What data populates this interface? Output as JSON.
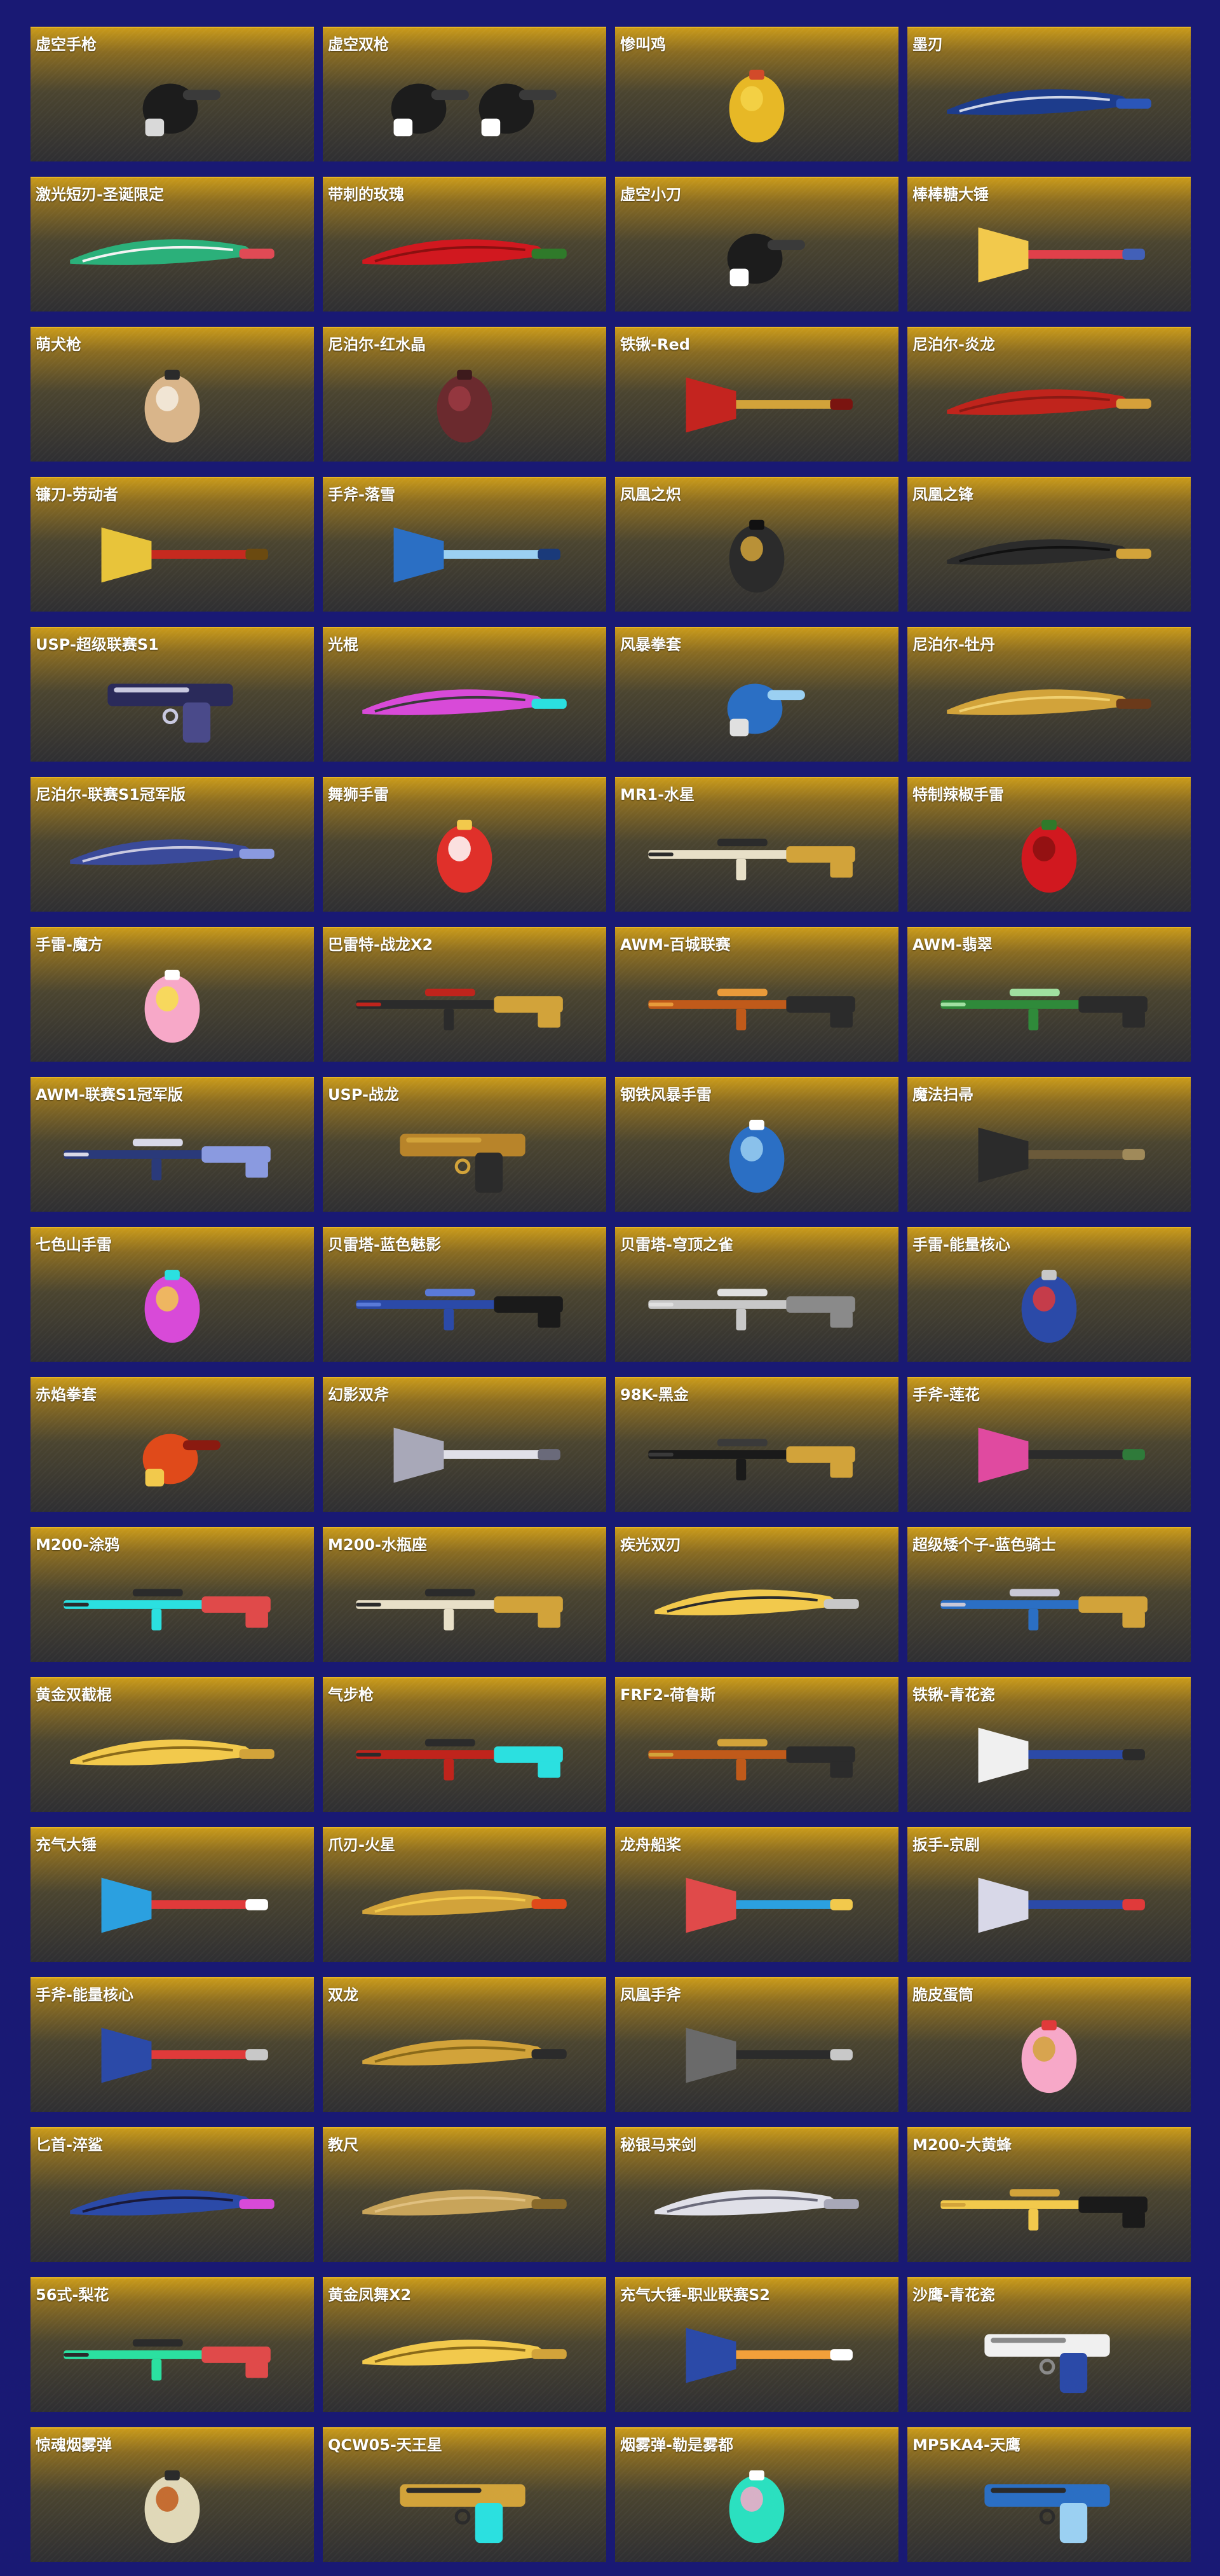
{
  "items": [
    {
      "name": "虚空手枪",
      "icon": "black-glove-finger-gun-icon",
      "colors": [
        "#1c1c1c",
        "#3a3a3a",
        "#d9d9d9"
      ]
    },
    {
      "name": "虚空双枪",
      "icon": "twin-black-glove-finger-guns-icon",
      "colors": [
        "#1c1c1c",
        "#3a3a3a",
        "#ffffff"
      ]
    },
    {
      "name": "惨叫鸡",
      "icon": "rubber-chicken-icon",
      "colors": [
        "#e7b826",
        "#f5d44a",
        "#d24a2a"
      ]
    },
    {
      "name": "墨刃",
      "icon": "folding-knife-blue-icon",
      "colors": [
        "#1d3c8c",
        "#2b56b8",
        "#cfd6e8"
      ]
    },
    {
      "name": "激光短刃-圣诞限定",
      "icon": "christmas-laser-blade-icon",
      "colors": [
        "#2bb07a",
        "#e04a55",
        "#f3f3f3"
      ]
    },
    {
      "name": "带刺的玫瑰",
      "icon": "rose-icon",
      "colors": [
        "#d1181f",
        "#2f7a2a",
        "#8a1010"
      ]
    },
    {
      "name": "虚空小刀",
      "icon": "black-glove-hand-icon",
      "colors": [
        "#1c1c1c",
        "#3a3a3a",
        "#ffffff"
      ]
    },
    {
      "name": "棒棒糖大锤",
      "icon": "lollipop-hammer-icon",
      "colors": [
        "#f2c94c",
        "#e0404a",
        "#4260b8"
      ]
    },
    {
      "name": "萌犬枪",
      "icon": "shiba-dog-icon",
      "colors": [
        "#d9b58a",
        "#f5ede0",
        "#2b2b2b"
      ]
    },
    {
      "name": "尼泊尔-红水晶",
      "icon": "red-crystal-kukri-icon",
      "colors": [
        "#6b2a2e",
        "#9b3a42",
        "#3d1a1c"
      ]
    },
    {
      "name": "铁锹-Red",
      "icon": "red-dragon-shovel-icon",
      "colors": [
        "#c4241f",
        "#d2a33a",
        "#7a1410"
      ]
    },
    {
      "name": "尼泊尔-炎龙",
      "icon": "flame-dragon-kukri-icon",
      "colors": [
        "#c0241c",
        "#d6a03a",
        "#8a1a14"
      ]
    },
    {
      "name": "镰刀-劳动者",
      "icon": "golden-sickle-icon",
      "colors": [
        "#e8c43a",
        "#c62a1f",
        "#6b4a10"
      ]
    },
    {
      "name": "手斧-落雪",
      "icon": "snow-axe-icon",
      "colors": [
        "#2b6fc4",
        "#9bd0f2",
        "#1a3a7a"
      ]
    },
    {
      "name": "凤凰之炽",
      "icon": "phoenix-grenade-icon",
      "colors": [
        "#2b2b2b",
        "#d2a33a",
        "#111111"
      ]
    },
    {
      "name": "凤凰之锋",
      "icon": "phoenix-blade-icon",
      "colors": [
        "#2b2b2b",
        "#d2a33a",
        "#111111"
      ]
    },
    {
      "name": "USP-超级联赛S1",
      "icon": "usp-silenced-pistol-icon",
      "colors": [
        "#2a2a5a",
        "#4a4a8a",
        "#c9c9e0"
      ]
    },
    {
      "name": "光棍",
      "icon": "neon-stick-icon",
      "colors": [
        "#d84ad8",
        "#2be0e0",
        "#3a3a3a"
      ]
    },
    {
      "name": "风暴拳套",
      "icon": "storm-glove-icon",
      "colors": [
        "#2b6fc4",
        "#9bd0f2",
        "#e0e0e0"
      ]
    },
    {
      "name": "尼泊尔-牡丹",
      "icon": "peony-kukri-icon",
      "colors": [
        "#d2a33a",
        "#6b3a1a",
        "#f0d070"
      ]
    },
    {
      "name": "尼泊尔-联赛S1冠军版",
      "icon": "league-kukri-icon",
      "colors": [
        "#3a4a9a",
        "#8a9ae0",
        "#c9c9e0"
      ]
    },
    {
      "name": "舞狮手雷",
      "icon": "lion-dance-grenade-icon",
      "colors": [
        "#e0302a",
        "#ffffff",
        "#f2c94c"
      ]
    },
    {
      "name": "MR1-水星",
      "icon": "mercury-sniper-icon",
      "colors": [
        "#e8e0c8",
        "#d2a33a",
        "#2b2b2b"
      ]
    },
    {
      "name": "特制辣椒手雷",
      "icon": "chili-pepper-icon",
      "colors": [
        "#d1181f",
        "#8a1010",
        "#2f7a2a"
      ]
    },
    {
      "name": "手雷-魔方",
      "icon": "rubiks-cube-icon",
      "colors": [
        "#f7a8c8",
        "#f7e04a",
        "#ffffff"
      ]
    },
    {
      "name": "巴雷特-战龙X2",
      "icon": "barrett-war-dragon-icon",
      "colors": [
        "#2b2b2b",
        "#d2a33a",
        "#c0241c"
      ]
    },
    {
      "name": "AWM-百城联赛",
      "icon": "awm-league-sniper-icon",
      "colors": [
        "#c05a1a",
        "#2b2b2b",
        "#e89a3a"
      ]
    },
    {
      "name": "AWM-翡翠",
      "icon": "awm-jade-sniper-icon",
      "colors": [
        "#2f8a3a",
        "#2b2b2b",
        "#a0e0a0"
      ]
    },
    {
      "name": "AWM-联赛S1冠军版",
      "icon": "awm-champion-sniper-icon",
      "colors": [
        "#2a3a7a",
        "#8a9ae0",
        "#d9d9e8"
      ]
    },
    {
      "name": "USP-战龙",
      "icon": "usp-war-dragon-icon",
      "colors": [
        "#b8842a",
        "#2b2b2b",
        "#d2a33a"
      ]
    },
    {
      "name": "钢铁风暴手雷",
      "icon": "blue-orb-grenade-icon",
      "colors": [
        "#2b6fc4",
        "#9bd0f2",
        "#ffffff"
      ]
    },
    {
      "name": "魔法扫帚",
      "icon": "magic-broom-icon",
      "colors": [
        "#2b2b2b",
        "#6b5a3a",
        "#a08a5a"
      ]
    },
    {
      "name": "七色山手雷",
      "icon": "seven-color-crystal-icon",
      "colors": [
        "#d84ad8",
        "#f2c94c",
        "#2be0e0"
      ]
    },
    {
      "name": "贝雷塔-蓝色魅影",
      "icon": "beretta-blue-shotgun-icon",
      "colors": [
        "#2b4aa8",
        "#1a1a1a",
        "#5a7ad8"
      ]
    },
    {
      "name": "贝雷塔-穹顶之雀",
      "icon": "beretta-silver-shotgun-icon",
      "colors": [
        "#c8c8c8",
        "#8a8a8a",
        "#e0e0e0"
      ]
    },
    {
      "name": "手雷-能量核心",
      "icon": "energy-core-grenade-icon",
      "colors": [
        "#2b4aa8",
        "#e03a3a",
        "#c8c8c8"
      ]
    },
    {
      "name": "赤焰拳套",
      "icon": "flame-glove-icon",
      "colors": [
        "#e04a1a",
        "#8a1a10",
        "#f2c94c"
      ]
    },
    {
      "name": "幻影双斧",
      "icon": "phantom-double-axe-icon",
      "colors": [
        "#a8a8b8",
        "#e0e0e8",
        "#6a6a7a"
      ]
    },
    {
      "name": "98K-黑金",
      "icon": "98k-black-gold-rifle-icon",
      "colors": [
        "#1a1a1a",
        "#d2a33a",
        "#3a3a3a"
      ]
    },
    {
      "name": "手斧-莲花",
      "icon": "lotus-axe-icon",
      "colors": [
        "#e04aa0",
        "#2b2b2b",
        "#2f7a3a"
      ]
    },
    {
      "name": "M200-涂鸦",
      "icon": "m200-graffiti-sniper-icon",
      "colors": [
        "#2be0e0",
        "#e04a4a",
        "#2b2b2b"
      ]
    },
    {
      "name": "M200-水瓶座",
      "icon": "m200-aquarius-sniper-icon",
      "colors": [
        "#e8e0c8",
        "#d2a33a",
        "#2b2b2b"
      ]
    },
    {
      "name": "疾光双刃",
      "icon": "swift-light-blade-icon",
      "colors": [
        "#f2c94c",
        "#c8c8c8",
        "#2b2b2b"
      ]
    },
    {
      "name": "超级矮个子-蓝色骑士",
      "icon": "blue-knight-shotgun-icon",
      "colors": [
        "#2b6fc4",
        "#d2a33a",
        "#c8c8d8"
      ]
    },
    {
      "name": "黄金双截棍",
      "icon": "golden-nunchaku-icon",
      "colors": [
        "#f2c94c",
        "#d2a33a",
        "#8a6a1a"
      ]
    },
    {
      "name": "气步枪",
      "icon": "air-rifle-icon",
      "colors": [
        "#c0241c",
        "#2be0e0",
        "#2b2b2b"
      ]
    },
    {
      "name": "FRF2-荷鲁斯",
      "icon": "frf2-horus-sniper-icon",
      "colors": [
        "#c05a1a",
        "#2b2b2b",
        "#d2a33a"
      ]
    },
    {
      "name": "铁锹-青花瓷",
      "icon": "porcelain-shovel-icon",
      "colors": [
        "#f0f0f0",
        "#2b4aa8",
        "#2b2b2b"
      ]
    },
    {
      "name": "充气大锤",
      "icon": "inflatable-hammer-icon",
      "colors": [
        "#2ba0e0",
        "#e03a3a",
        "#ffffff"
      ]
    },
    {
      "name": "爪刃-火星",
      "icon": "mars-claw-icon",
      "colors": [
        "#d2a33a",
        "#e04a1a",
        "#f2c94c"
      ]
    },
    {
      "name": "龙舟船桨",
      "icon": "dragon-boat-paddle-icon",
      "colors": [
        "#e04a4a",
        "#2ba0e0",
        "#f2c94c"
      ]
    },
    {
      "name": "扳手-京剧",
      "icon": "opera-wrench-icon",
      "colors": [
        "#d8d8e8",
        "#2b4aa8",
        "#e03a3a"
      ]
    },
    {
      "name": "手斧-能量核心",
      "icon": "energy-core-axe-icon",
      "colors": [
        "#2b4aa8",
        "#e03a3a",
        "#c8c8c8"
      ]
    },
    {
      "name": "双龙",
      "icon": "twin-dragon-spear-icon",
      "colors": [
        "#d2a33a",
        "#2b2b2b",
        "#8a6a1a"
      ]
    },
    {
      "name": "凤凰手斧",
      "icon": "phoenix-axe-icon",
      "colors": [
        "#6a6a6a",
        "#2b2b2b",
        "#c8c8c8"
      ]
    },
    {
      "name": "脆皮蛋筒",
      "icon": "ice-cream-cone-icon",
      "colors": [
        "#f7a8c8",
        "#d2a33a",
        "#e03a3a"
      ]
    },
    {
      "name": "匕首-淬鲨",
      "icon": "shark-dagger-icon",
      "colors": [
        "#2b4aa8",
        "#d84ad8",
        "#1a1a3a"
      ]
    },
    {
      "name": "教尺",
      "icon": "teacher-ruler-icon",
      "colors": [
        "#c8a45a",
        "#8a6a2a",
        "#e0c080"
      ]
    },
    {
      "name": "秘银马来剑",
      "icon": "mithril-kris-sword-icon",
      "colors": [
        "#e0e0e8",
        "#a8a8b8",
        "#6a6a7a"
      ]
    },
    {
      "name": "M200-大黄蜂",
      "icon": "m200-bumblebee-sniper-icon",
      "colors": [
        "#f2c94c",
        "#1a1a1a",
        "#d2a33a"
      ]
    },
    {
      "name": "56式-梨花",
      "icon": "type56-pear-blossom-rifle-icon",
      "colors": [
        "#2be0a0",
        "#e04a4a",
        "#2b2b2b"
      ]
    },
    {
      "name": "黄金凤舞X2",
      "icon": "golden-phoenix-dance-blades-icon",
      "colors": [
        "#f2c94c",
        "#d2a33a",
        "#8a6a1a"
      ]
    },
    {
      "name": "充气大锤-职业联赛S2",
      "icon": "league-inflatable-hammer-icon",
      "colors": [
        "#2b4aa8",
        "#f2a03a",
        "#ffffff"
      ]
    },
    {
      "name": "沙鹰-青花瓷",
      "icon": "porcelain-desert-eagle-icon",
      "colors": [
        "#f0f0f0",
        "#2b4aa8",
        "#8a8a8a"
      ]
    },
    {
      "name": "惊魂烟雾弹",
      "icon": "horror-smoke-grenade-icon",
      "colors": [
        "#e0d8b8",
        "#c05a1a",
        "#2b2b2b"
      ]
    },
    {
      "name": "QCW05-天王星",
      "icon": "qcw05-uranus-smg-icon",
      "colors": [
        "#d2a33a",
        "#2be0e0",
        "#2b2b2b"
      ]
    },
    {
      "name": "烟雾弹-勒是雾都",
      "icon": "foggy-city-smoke-grenade-icon",
      "colors": [
        "#2be0c0",
        "#f7a8c8",
        "#ffffff"
      ]
    },
    {
      "name": "MP5KA4-天鹰",
      "icon": "mp5ka4-sky-eagle-smg-icon",
      "colors": [
        "#2b6fc4",
        "#9bd0f2",
        "#2b2b2b"
      ]
    }
  ]
}
